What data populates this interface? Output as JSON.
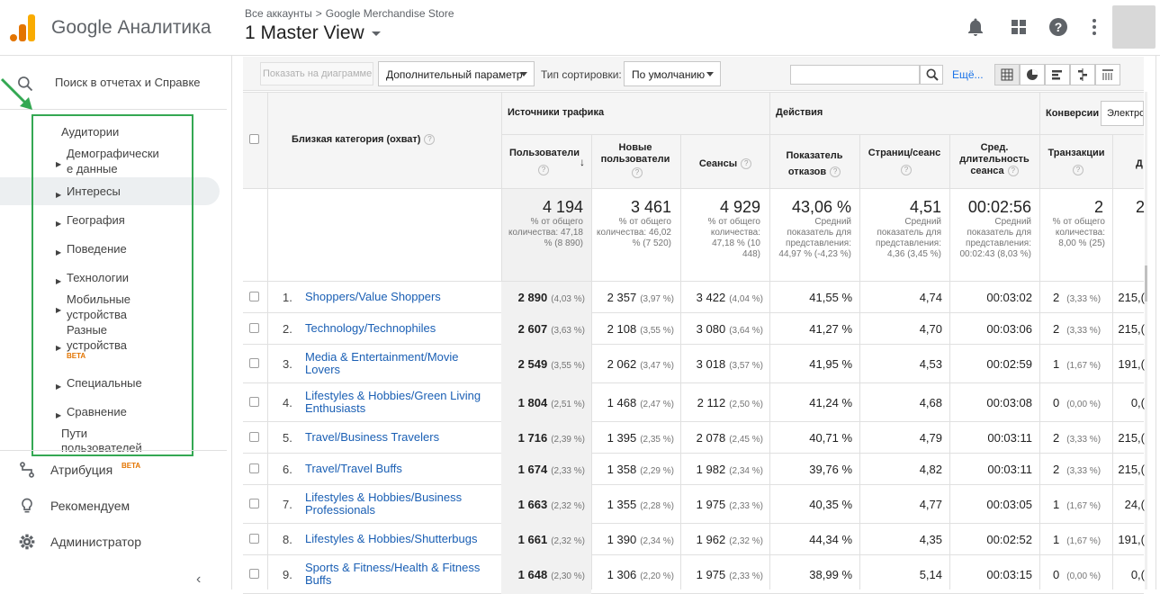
{
  "header": {
    "product": "Google Аналитика",
    "breadcrumb": [
      "Все аккаунты",
      ">",
      "Google Merchandise Store"
    ],
    "view": "1 Master View",
    "colors": {
      "logo_dark": "#e37400",
      "logo_light": "#f9ab00"
    }
  },
  "sidebar": {
    "search_text": "Поиск в отчетах и Справке",
    "audience_title": "Аудитории",
    "items": [
      {
        "label": "Демографически\nе данные"
      },
      {
        "label": "Интересы"
      },
      {
        "label": "География"
      },
      {
        "label": "Поведение"
      },
      {
        "label": "Технологии"
      },
      {
        "label": "Мобильные\nустройства"
      },
      {
        "label": "Разные\nустройства"
      },
      {
        "label": "Специальные"
      },
      {
        "label": "Сравнение"
      }
    ],
    "cross_device_badge": "BETA",
    "paths_label": "Пути\nпользователей",
    "bottom": [
      {
        "label": "Атрибуция",
        "badge": "BETA",
        "icon": "attribution-icon"
      },
      {
        "label": "Рекомендуем",
        "icon": "lightbulb-icon"
      },
      {
        "label": "Администратор",
        "icon": "gear-icon"
      }
    ],
    "collapse": "‹"
  },
  "toolbar": {
    "plot_button": "Показать на диаграмме",
    "secondary_dim": "Дополнительный параметр",
    "sort_label": "Тип сортировки:",
    "sort_value": "По умолчанию",
    "search_value": "",
    "more_link": "Ещё..."
  },
  "table": {
    "dimension_header": "Близкая категория (охват)",
    "groups": {
      "acquisition": "Источники трафика",
      "behavior": "Действия",
      "conversions": "Конверсии",
      "conv_select": "Электро"
    },
    "columns": {
      "users": "Пользователи",
      "new_users": "Новые пользователи",
      "sessions": "Сеансы",
      "bounce": "Показатель отказов",
      "pages": "Страниц/сеанс",
      "duration": "Сред. длительность сеанса",
      "transactions": "Транзакции",
      "revenue_partial": "Д"
    },
    "totals": {
      "users": "4 194",
      "users_sub": "% от общего количества: 47,18 % (8 890)",
      "new_users": "3 461",
      "new_users_sub": "% от общего количества: 46,02 % (7 520)",
      "sessions": "4 929",
      "sessions_sub": "% от общего количества: 47,18 % (10 448)",
      "bounce": "43,06 %",
      "bounce_sub": "Средний показатель для представления: 44,97 % (-4,23 %)",
      "pages": "4,51",
      "pages_sub": "Средний показатель для представления: 4,36 (3,45 %)",
      "duration": "00:02:56",
      "duration_sub": "Средний показатель для представления: 00:02:43 (8,03 %)",
      "transactions": "2",
      "transactions_sub": "% от общего количества: 8,00 % (25)",
      "revenue_partial": "2"
    },
    "rows": [
      {
        "n": "1.",
        "cat": "Shoppers/Value Shoppers",
        "users": "2 890",
        "users_p": "(4,03 %)",
        "new": "2 357",
        "new_p": "(3,97 %)",
        "sess": "3 422",
        "sess_p": "(4,04 %)",
        "bounce": "41,55 %",
        "pages": "4,74",
        "dur": "00:03:02",
        "tr": "2",
        "tr_p": "(3,33 %)",
        "rev": "215,("
      },
      {
        "n": "2.",
        "cat": "Technology/Technophiles",
        "users": "2 607",
        "users_p": "(3,63 %)",
        "new": "2 108",
        "new_p": "(3,55 %)",
        "sess": "3 080",
        "sess_p": "(3,64 %)",
        "bounce": "41,27 %",
        "pages": "4,70",
        "dur": "00:03:06",
        "tr": "2",
        "tr_p": "(3,33 %)",
        "rev": "215,("
      },
      {
        "n": "3.",
        "cat": "Media & Entertainment/Movie Lovers",
        "users": "2 549",
        "users_p": "(3,55 %)",
        "new": "2 062",
        "new_p": "(3,47 %)",
        "sess": "3 018",
        "sess_p": "(3,57 %)",
        "bounce": "41,95 %",
        "pages": "4,53",
        "dur": "00:02:59",
        "tr": "1",
        "tr_p": "(1,67 %)",
        "rev": "191,("
      },
      {
        "n": "4.",
        "cat": "Lifestyles & Hobbies/Green Living Enthusiasts",
        "users": "1 804",
        "users_p": "(2,51 %)",
        "new": "1 468",
        "new_p": "(2,47 %)",
        "sess": "2 112",
        "sess_p": "(2,50 %)",
        "bounce": "41,24 %",
        "pages": "4,68",
        "dur": "00:03:08",
        "tr": "0",
        "tr_p": "(0,00 %)",
        "rev": "0,("
      },
      {
        "n": "5.",
        "cat": "Travel/Business Travelers",
        "users": "1 716",
        "users_p": "(2,39 %)",
        "new": "1 395",
        "new_p": "(2,35 %)",
        "sess": "2 078",
        "sess_p": "(2,45 %)",
        "bounce": "40,71 %",
        "pages": "4,79",
        "dur": "00:03:11",
        "tr": "2",
        "tr_p": "(3,33 %)",
        "rev": "215,("
      },
      {
        "n": "6.",
        "cat": "Travel/Travel Buffs",
        "users": "1 674",
        "users_p": "(2,33 %)",
        "new": "1 358",
        "new_p": "(2,29 %)",
        "sess": "1 982",
        "sess_p": "(2,34 %)",
        "bounce": "39,76 %",
        "pages": "4,82",
        "dur": "00:03:11",
        "tr": "2",
        "tr_p": "(3,33 %)",
        "rev": "215,("
      },
      {
        "n": "7.",
        "cat": "Lifestyles & Hobbies/Business Professionals",
        "users": "1 663",
        "users_p": "(2,32 %)",
        "new": "1 355",
        "new_p": "(2,28 %)",
        "sess": "1 975",
        "sess_p": "(2,33 %)",
        "bounce": "40,35 %",
        "pages": "4,77",
        "dur": "00:03:05",
        "tr": "1",
        "tr_p": "(1,67 %)",
        "rev": "24,("
      },
      {
        "n": "8.",
        "cat": "Lifestyles & Hobbies/Shutterbugs",
        "users": "1 661",
        "users_p": "(2,32 %)",
        "new": "1 390",
        "new_p": "(2,34 %)",
        "sess": "1 962",
        "sess_p": "(2,32 %)",
        "bounce": "44,34 %",
        "pages": "4,35",
        "dur": "00:02:52",
        "tr": "1",
        "tr_p": "(1,67 %)",
        "rev": "191,("
      },
      {
        "n": "9.",
        "cat": "Sports & Fitness/Health & Fitness Buffs",
        "users": "1 648",
        "users_p": "(2,30 %)",
        "new": "1 306",
        "new_p": "(2,20 %)",
        "sess": "1 975",
        "sess_p": "(2,33 %)",
        "bounce": "38,99 %",
        "pages": "5,14",
        "dur": "00:03:15",
        "tr": "0",
        "tr_p": "(0,00 %)",
        "rev": "0,("
      }
    ]
  }
}
